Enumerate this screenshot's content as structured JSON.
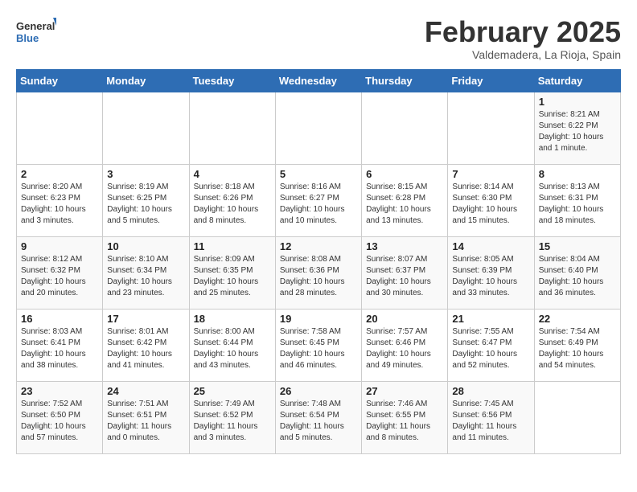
{
  "header": {
    "logo_general": "General",
    "logo_blue": "Blue",
    "month_title": "February 2025",
    "location": "Valdemadera, La Rioja, Spain"
  },
  "weekdays": [
    "Sunday",
    "Monday",
    "Tuesday",
    "Wednesday",
    "Thursday",
    "Friday",
    "Saturday"
  ],
  "weeks": [
    [
      {
        "day": "",
        "info": ""
      },
      {
        "day": "",
        "info": ""
      },
      {
        "day": "",
        "info": ""
      },
      {
        "day": "",
        "info": ""
      },
      {
        "day": "",
        "info": ""
      },
      {
        "day": "",
        "info": ""
      },
      {
        "day": "1",
        "info": "Sunrise: 8:21 AM\nSunset: 6:22 PM\nDaylight: 10 hours\nand 1 minute."
      }
    ],
    [
      {
        "day": "2",
        "info": "Sunrise: 8:20 AM\nSunset: 6:23 PM\nDaylight: 10 hours\nand 3 minutes."
      },
      {
        "day": "3",
        "info": "Sunrise: 8:19 AM\nSunset: 6:25 PM\nDaylight: 10 hours\nand 5 minutes."
      },
      {
        "day": "4",
        "info": "Sunrise: 8:18 AM\nSunset: 6:26 PM\nDaylight: 10 hours\nand 8 minutes."
      },
      {
        "day": "5",
        "info": "Sunrise: 8:16 AM\nSunset: 6:27 PM\nDaylight: 10 hours\nand 10 minutes."
      },
      {
        "day": "6",
        "info": "Sunrise: 8:15 AM\nSunset: 6:28 PM\nDaylight: 10 hours\nand 13 minutes."
      },
      {
        "day": "7",
        "info": "Sunrise: 8:14 AM\nSunset: 6:30 PM\nDaylight: 10 hours\nand 15 minutes."
      },
      {
        "day": "8",
        "info": "Sunrise: 8:13 AM\nSunset: 6:31 PM\nDaylight: 10 hours\nand 18 minutes."
      }
    ],
    [
      {
        "day": "9",
        "info": "Sunrise: 8:12 AM\nSunset: 6:32 PM\nDaylight: 10 hours\nand 20 minutes."
      },
      {
        "day": "10",
        "info": "Sunrise: 8:10 AM\nSunset: 6:34 PM\nDaylight: 10 hours\nand 23 minutes."
      },
      {
        "day": "11",
        "info": "Sunrise: 8:09 AM\nSunset: 6:35 PM\nDaylight: 10 hours\nand 25 minutes."
      },
      {
        "day": "12",
        "info": "Sunrise: 8:08 AM\nSunset: 6:36 PM\nDaylight: 10 hours\nand 28 minutes."
      },
      {
        "day": "13",
        "info": "Sunrise: 8:07 AM\nSunset: 6:37 PM\nDaylight: 10 hours\nand 30 minutes."
      },
      {
        "day": "14",
        "info": "Sunrise: 8:05 AM\nSunset: 6:39 PM\nDaylight: 10 hours\nand 33 minutes."
      },
      {
        "day": "15",
        "info": "Sunrise: 8:04 AM\nSunset: 6:40 PM\nDaylight: 10 hours\nand 36 minutes."
      }
    ],
    [
      {
        "day": "16",
        "info": "Sunrise: 8:03 AM\nSunset: 6:41 PM\nDaylight: 10 hours\nand 38 minutes."
      },
      {
        "day": "17",
        "info": "Sunrise: 8:01 AM\nSunset: 6:42 PM\nDaylight: 10 hours\nand 41 minutes."
      },
      {
        "day": "18",
        "info": "Sunrise: 8:00 AM\nSunset: 6:44 PM\nDaylight: 10 hours\nand 43 minutes."
      },
      {
        "day": "19",
        "info": "Sunrise: 7:58 AM\nSunset: 6:45 PM\nDaylight: 10 hours\nand 46 minutes."
      },
      {
        "day": "20",
        "info": "Sunrise: 7:57 AM\nSunset: 6:46 PM\nDaylight: 10 hours\nand 49 minutes."
      },
      {
        "day": "21",
        "info": "Sunrise: 7:55 AM\nSunset: 6:47 PM\nDaylight: 10 hours\nand 52 minutes."
      },
      {
        "day": "22",
        "info": "Sunrise: 7:54 AM\nSunset: 6:49 PM\nDaylight: 10 hours\nand 54 minutes."
      }
    ],
    [
      {
        "day": "23",
        "info": "Sunrise: 7:52 AM\nSunset: 6:50 PM\nDaylight: 10 hours\nand 57 minutes."
      },
      {
        "day": "24",
        "info": "Sunrise: 7:51 AM\nSunset: 6:51 PM\nDaylight: 11 hours\nand 0 minutes."
      },
      {
        "day": "25",
        "info": "Sunrise: 7:49 AM\nSunset: 6:52 PM\nDaylight: 11 hours\nand 3 minutes."
      },
      {
        "day": "26",
        "info": "Sunrise: 7:48 AM\nSunset: 6:54 PM\nDaylight: 11 hours\nand 5 minutes."
      },
      {
        "day": "27",
        "info": "Sunrise: 7:46 AM\nSunset: 6:55 PM\nDaylight: 11 hours\nand 8 minutes."
      },
      {
        "day": "28",
        "info": "Sunrise: 7:45 AM\nSunset: 6:56 PM\nDaylight: 11 hours\nand 11 minutes."
      },
      {
        "day": "",
        "info": ""
      }
    ]
  ]
}
